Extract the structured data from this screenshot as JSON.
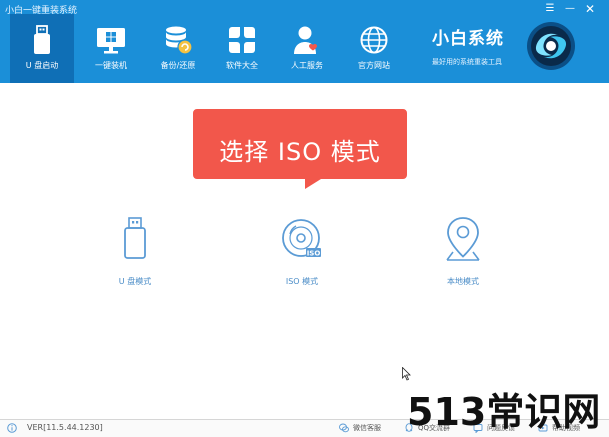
{
  "app": {
    "title": "小白一键重装系统"
  },
  "nav": {
    "items": [
      {
        "label": "U 盘启动",
        "icon": "usb-drive-icon",
        "active": true
      },
      {
        "label": "一键装机",
        "icon": "monitor-windows-icon",
        "active": false
      },
      {
        "label": "备份/还原",
        "icon": "database-backup-icon",
        "active": false
      },
      {
        "label": "软件大全",
        "icon": "app-grid-icon",
        "active": false
      },
      {
        "label": "人工服务",
        "icon": "support-agent-icon",
        "active": false
      },
      {
        "label": "官方网站",
        "icon": "globe-icon",
        "active": false
      }
    ]
  },
  "brand": {
    "name": "小白系统",
    "subtitle": "最好用的系统重装工具",
    "logo_icon": "brand-logo-icon"
  },
  "callout": {
    "text": "选择 ISO 模式",
    "color": "#f2574b"
  },
  "modes": [
    {
      "label": "U 盘模式",
      "icon": "usb-drive-icon"
    },
    {
      "label": "ISO 模式",
      "icon": "iso-disc-icon"
    },
    {
      "label": "本地模式",
      "icon": "location-pin-icon"
    }
  ],
  "footer": {
    "version": "VER[11.5.44.1230]",
    "links": [
      {
        "label": "微信客服",
        "icon": "wechat-icon"
      },
      {
        "label": "QQ交流群",
        "icon": "qq-icon"
      },
      {
        "label": "问题反馈",
        "icon": "feedback-icon"
      },
      {
        "label": "帮助视频",
        "icon": "help-video-icon"
      }
    ]
  },
  "watermark": {
    "text": "513常识网"
  },
  "colors": {
    "header": "#1b8fd8",
    "active_tab": "#0f6fb6",
    "mode_icon": "#5b9bd5",
    "callout": "#f2574b"
  }
}
